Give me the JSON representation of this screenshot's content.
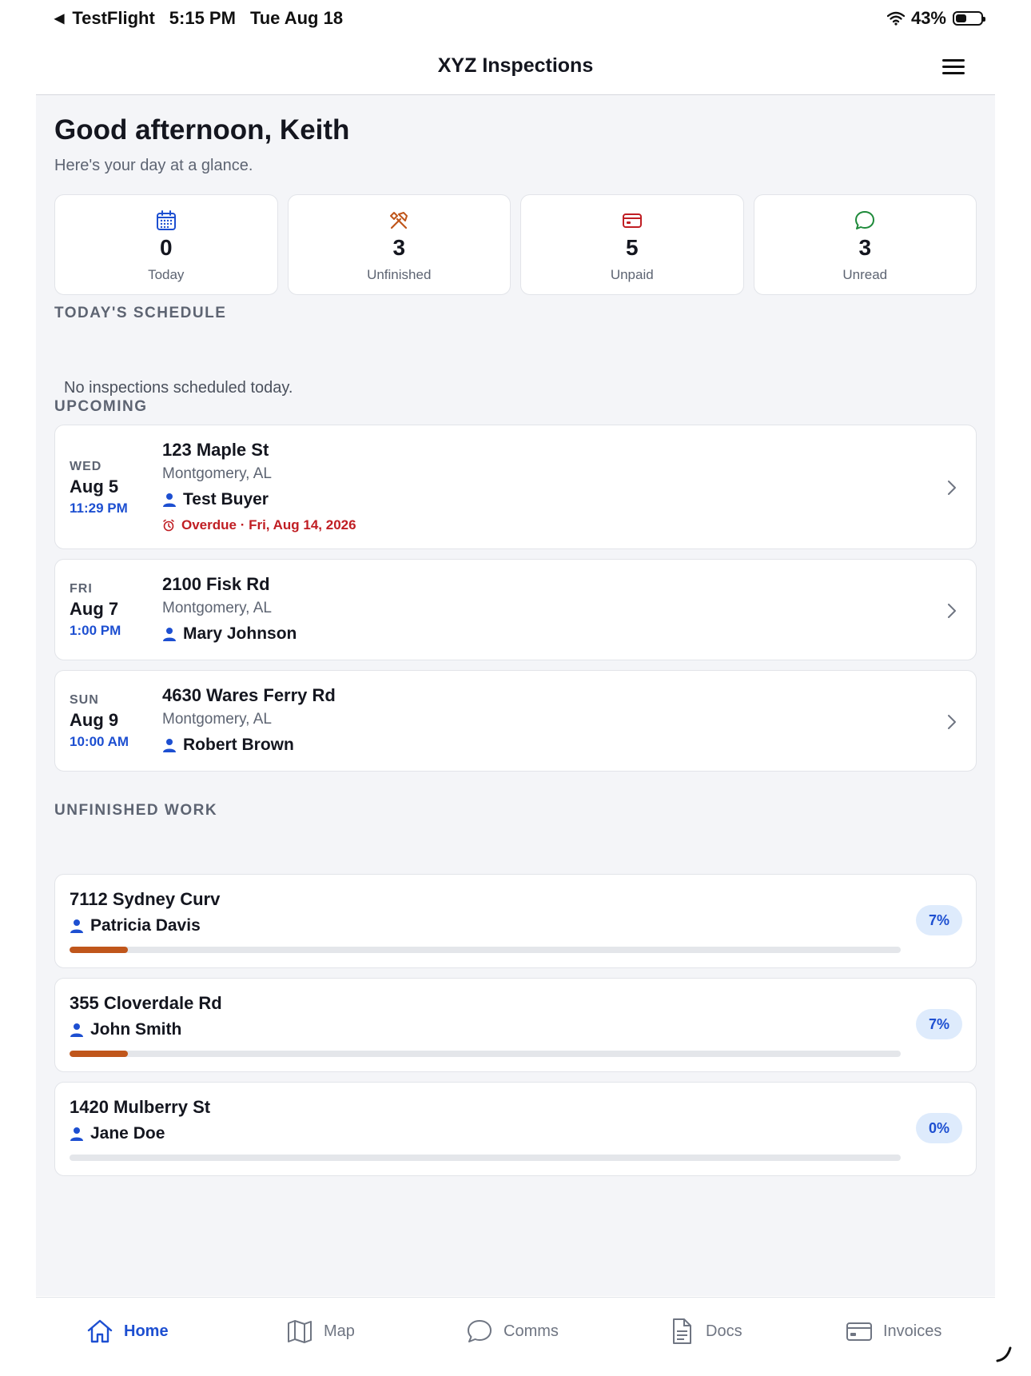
{
  "status_bar": {
    "back_app": "TestFlight",
    "time": "5:15 PM",
    "date": "Tue Aug 18",
    "battery": "43%"
  },
  "header": {
    "title": "XYZ Inspections"
  },
  "greeting": {
    "title": "Good afternoon, Keith",
    "subtitle": "Here's your day at a glance."
  },
  "stats": [
    {
      "value": "0",
      "label": "Today",
      "icon": "calendar-icon",
      "color": "#1d4fd1"
    },
    {
      "value": "3",
      "label": "Unfinished",
      "icon": "tools-icon",
      "color": "#c0561b"
    },
    {
      "value": "5",
      "label": "Unpaid",
      "icon": "credit-card-icon",
      "color": "#c01e23"
    },
    {
      "value": "3",
      "label": "Unread",
      "icon": "chat-bubble-icon",
      "color": "#1e8a3a"
    }
  ],
  "schedule": {
    "heading": "TODAY'S SCHEDULE",
    "empty": "No inspections scheduled today."
  },
  "upcoming": {
    "heading": "UPCOMING",
    "items": [
      {
        "dow": "WED",
        "date": "Aug 5",
        "time": "11:29 PM",
        "address": "123 Maple St",
        "city": "Montgomery, AL",
        "client": "Test Buyer",
        "overdue": "Overdue · Fri, Aug 14, 2026"
      },
      {
        "dow": "FRI",
        "date": "Aug 7",
        "time": "1:00 PM",
        "address": "2100 Fisk Rd",
        "city": "Montgomery, AL",
        "client": "Mary Johnson"
      },
      {
        "dow": "SUN",
        "date": "Aug 9",
        "time": "10:00 AM",
        "address": "4630 Wares Ferry Rd",
        "city": "Montgomery, AL",
        "client": "Robert Brown"
      }
    ]
  },
  "unfinished": {
    "heading": "UNFINISHED WORK",
    "items": [
      {
        "address": "7112 Sydney Curv",
        "client": "Patricia Davis",
        "percent": "7%",
        "progress": 0.07
      },
      {
        "address": "355 Cloverdale Rd",
        "client": "John Smith",
        "percent": "7%",
        "progress": 0.07
      },
      {
        "address": "1420 Mulberry St",
        "client": "Jane Doe",
        "percent": "0%",
        "progress": 0
      }
    ]
  },
  "tabs": [
    {
      "label": "Home",
      "icon": "home-icon",
      "active": true
    },
    {
      "label": "Map",
      "icon": "map-icon"
    },
    {
      "label": "Comms",
      "icon": "chat-bubble-icon"
    },
    {
      "label": "Docs",
      "icon": "document-icon"
    },
    {
      "label": "Invoices",
      "icon": "credit-card-icon"
    }
  ],
  "colors": {
    "accent": "#1d4fd1",
    "progress": "#c0561b",
    "danger": "#c01e23",
    "background": "#f4f5f8"
  }
}
